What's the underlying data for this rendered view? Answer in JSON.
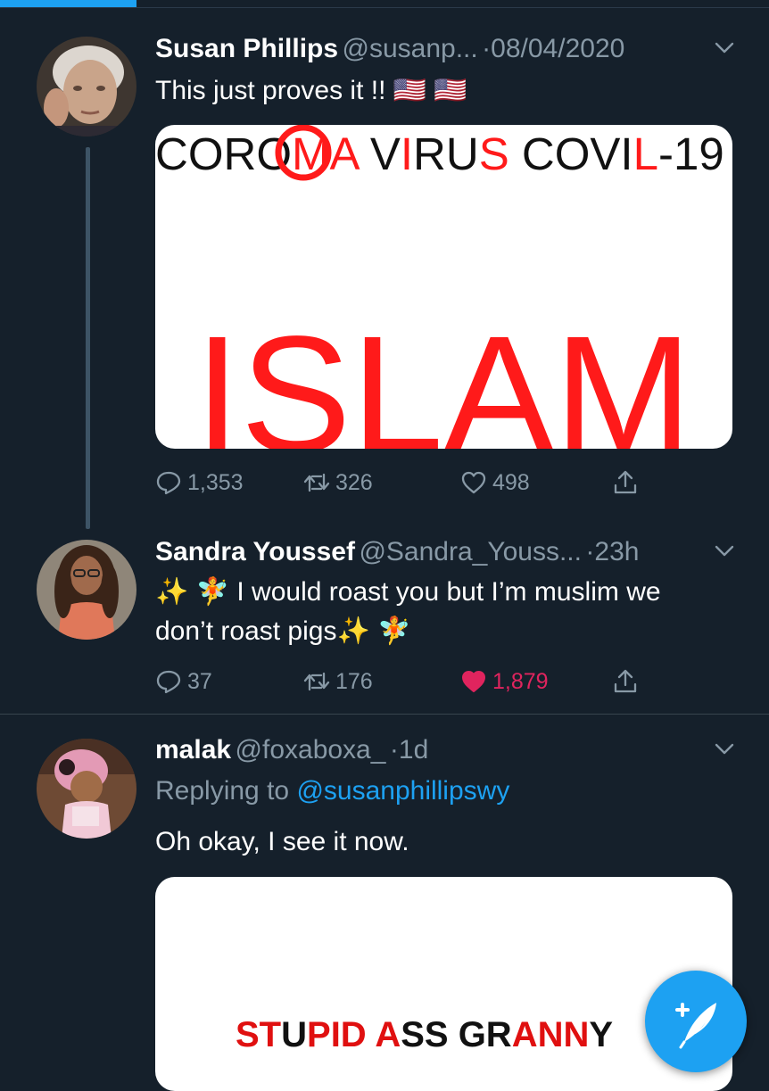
{
  "colors": {
    "background": "#15202b",
    "accent": "#1da1f2",
    "secondary_text": "#8899a6",
    "like": "#e0245e",
    "image_red": "#ff1a1a"
  },
  "tweets": [
    {
      "name": "Susan Phillips",
      "handle": "@susanp...",
      "time": "08/04/2020",
      "text": "This  just proves it !! 🇺🇸 🇺🇸",
      "image": {
        "top_line": [
          "CORO",
          "M",
          "A",
          " V",
          "I",
          "RU",
          "S",
          " COVI",
          "L",
          "-19"
        ],
        "big_word": "ISLAM"
      },
      "actions": {
        "reply_icon": "reply-icon",
        "retweet_icon": "retweet-icon",
        "like_icon": "heart-icon",
        "share_icon": "share-icon"
      },
      "counts": {
        "replies": "1,353",
        "retweets": "326",
        "likes": "498"
      }
    },
    {
      "name": "Sandra Youssef",
      "handle": "@Sandra_Youss...",
      "time": "23h",
      "text_line1": "✨ 🧚 I would roast you but I’m muslim we",
      "text_line2": "don’t roast pigs✨ 🧚",
      "counts": {
        "replies": "37",
        "retweets": "176",
        "likes": "1,879"
      },
      "liked": true
    },
    {
      "name": "malak",
      "handle": "@foxaboxa_",
      "time": "1d",
      "replying_label": "Replying to",
      "replying_to": "@susanphillipswy",
      "text": "Oh okay, I see it now.",
      "image": {
        "caption_parts": [
          "ST",
          "U",
          "PID A",
          "SS",
          " GR",
          "AN",
          "N",
          "Y"
        ]
      }
    }
  ],
  "fab": {
    "icon": "compose-tweet-icon"
  }
}
